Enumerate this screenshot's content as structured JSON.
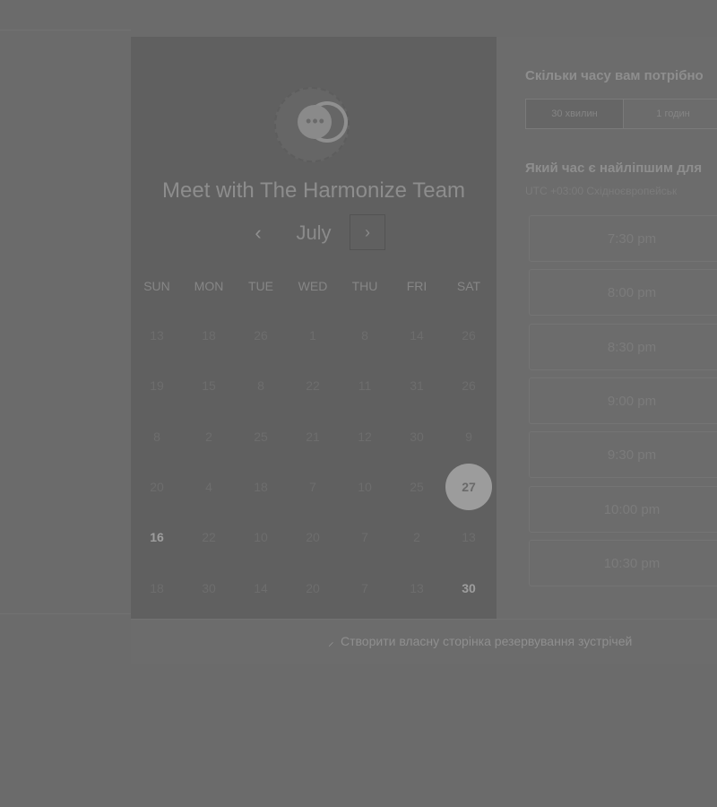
{
  "booking": {
    "title": "Meet with The Harmonize Team",
    "month": "July",
    "prev_symbol": "‹",
    "next_symbol": "›",
    "weekdays": [
      "SUN",
      "MON",
      "TUE",
      "WED",
      "THU",
      "FRI",
      "SAT"
    ],
    "calendar_rows": [
      [
        "13",
        "18",
        "26",
        "1",
        "8",
        "14",
        "26"
      ],
      [
        "19",
        "15",
        "8",
        "22",
        "11",
        "31",
        "26"
      ],
      [
        "8",
        "2",
        "25",
        "21",
        "12",
        "30",
        "9"
      ],
      [
        "20",
        "4",
        "18",
        "7",
        "10",
        "25",
        "27"
      ],
      [
        "16",
        "22",
        "10",
        "20",
        "7",
        "2",
        "13"
      ],
      [
        "18",
        "30",
        "14",
        "20",
        "7",
        "13",
        "30"
      ]
    ],
    "selected_date": "27",
    "available_dates": [
      "16",
      "30"
    ]
  },
  "times": {
    "duration_question": "Скільки часу вам потрібно",
    "durations": [
      "30 хвилин",
      "1 годин"
    ],
    "time_question": "Який час є найліпшим для",
    "timezone": "UTC +03:00 Східноєвропейськ",
    "slots": [
      "7:30 pm",
      "8:00 pm",
      "8:30 pm",
      "9:00 pm",
      "9:30 pm",
      "10:00 pm",
      "10:30 pm"
    ]
  },
  "footer": {
    "link_text": "Створити власну сторінка резервування зустрічей"
  },
  "colors": {
    "overlay": "#6b6b6b",
    "calendar_panel": "#606060",
    "selected_day": "#9c9c9c"
  }
}
